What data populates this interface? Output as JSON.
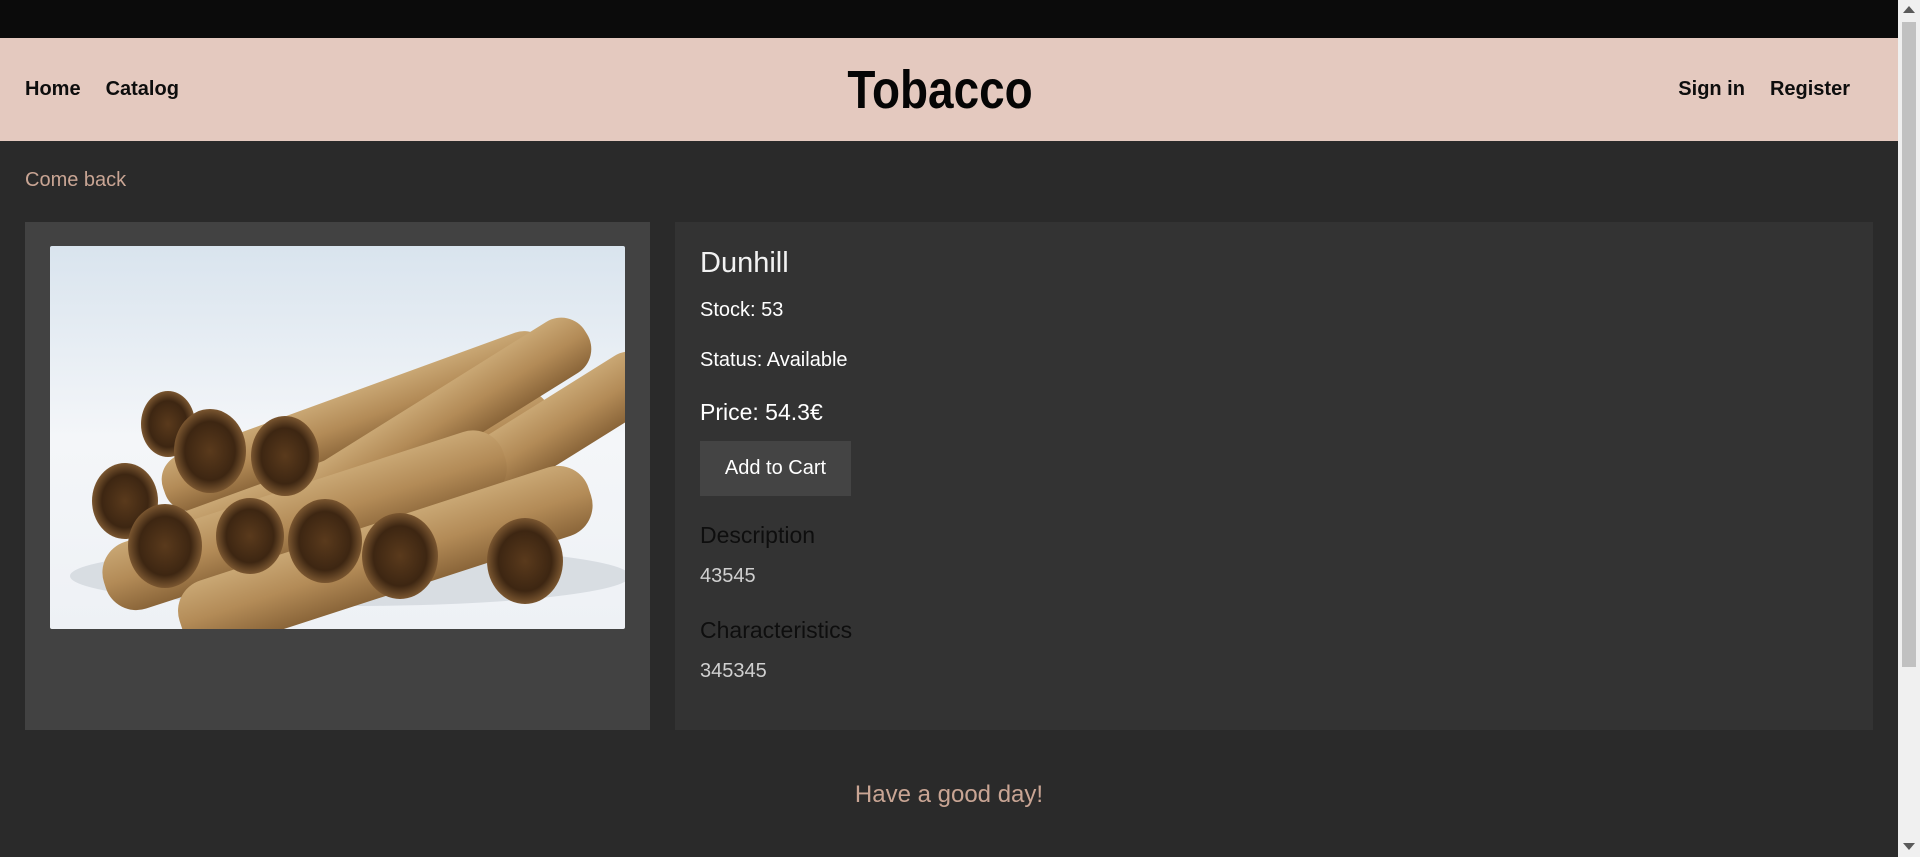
{
  "nav": {
    "home": "Home",
    "catalog": "Catalog",
    "brand": "Tobacco",
    "sign_in": "Sign in",
    "register": "Register"
  },
  "back_link": "Come back",
  "product": {
    "name": "Dunhill",
    "stock": "Stock: 53",
    "status": "Status: Available",
    "price": "Price: 54.3€",
    "add_to_cart": "Add to Cart",
    "description_heading": "Description",
    "description_value": "43545",
    "characteristics_heading": "Characteristics",
    "characteristics_value": "345345"
  },
  "footer": {
    "message": "Have a good day!"
  },
  "colors": {
    "header_bg": "#e4c9bf",
    "page_bg": "#2a2a2a",
    "accent_text": "#c9a594"
  }
}
